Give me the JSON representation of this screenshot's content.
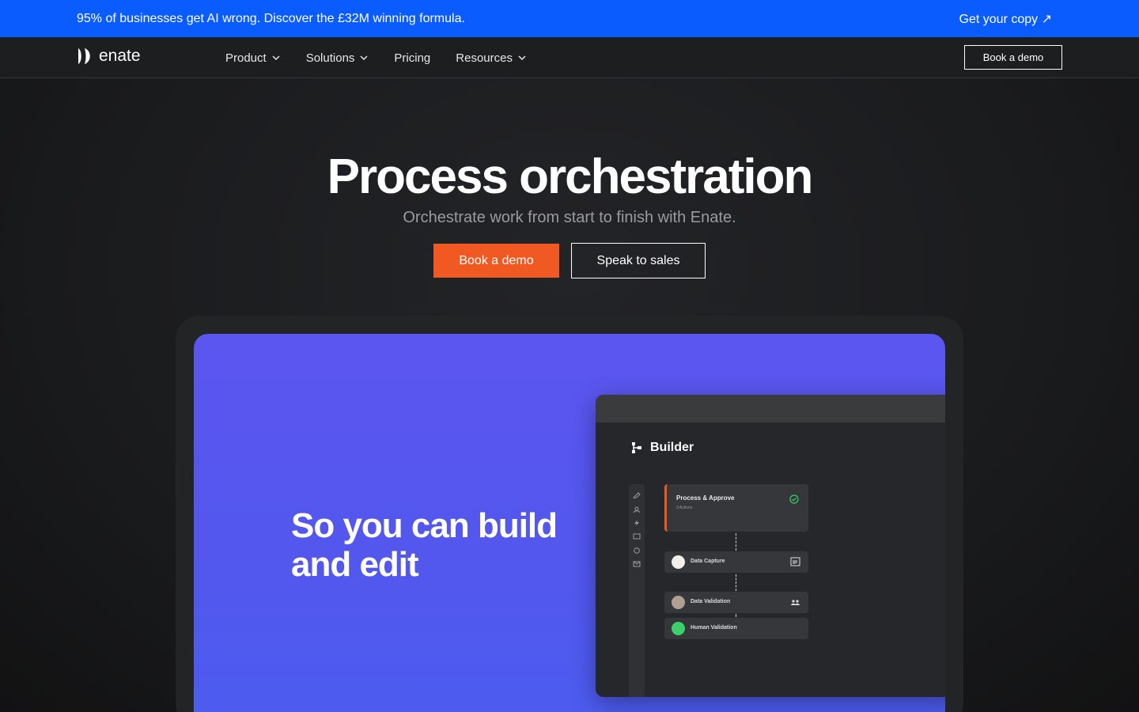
{
  "promo": {
    "text": "95% of businesses get AI wrong. Discover the £32M winning formula.",
    "cta": "Get your copy ↗"
  },
  "nav": {
    "logo_text": "enate",
    "items": [
      {
        "label": "Product",
        "has_dropdown": true
      },
      {
        "label": "Solutions",
        "has_dropdown": true
      },
      {
        "label": "Pricing",
        "has_dropdown": false
      },
      {
        "label": "Resources",
        "has_dropdown": true
      }
    ],
    "cta": "Book a demo"
  },
  "hero": {
    "title": "Process orchestration",
    "subtitle": "Orchestrate work from start to finish with Enate.",
    "primary_button": "Book a demo",
    "secondary_button": "Speak to sales"
  },
  "showcase": {
    "headline": "So you can build and edit",
    "app": {
      "title": "Builder",
      "main_card": {
        "title": "Process & Approve",
        "meta": "3 Actions"
      },
      "steps": [
        {
          "label": "Data Capture",
          "avatar_color": "#f3efe9",
          "badge": "ui-icon"
        },
        {
          "label": "Data Validation",
          "avatar_color": "#b0a093",
          "badge": "team-icon"
        },
        {
          "label": "Human Validation",
          "avatar_color": "#3ccf6a",
          "badge": ""
        }
      ]
    }
  },
  "colors": {
    "promo_bg": "#0a5cff",
    "accent_orange": "#f05a22",
    "screen_purple": "#5b56ef",
    "page_bg": "#1b1c1e"
  }
}
